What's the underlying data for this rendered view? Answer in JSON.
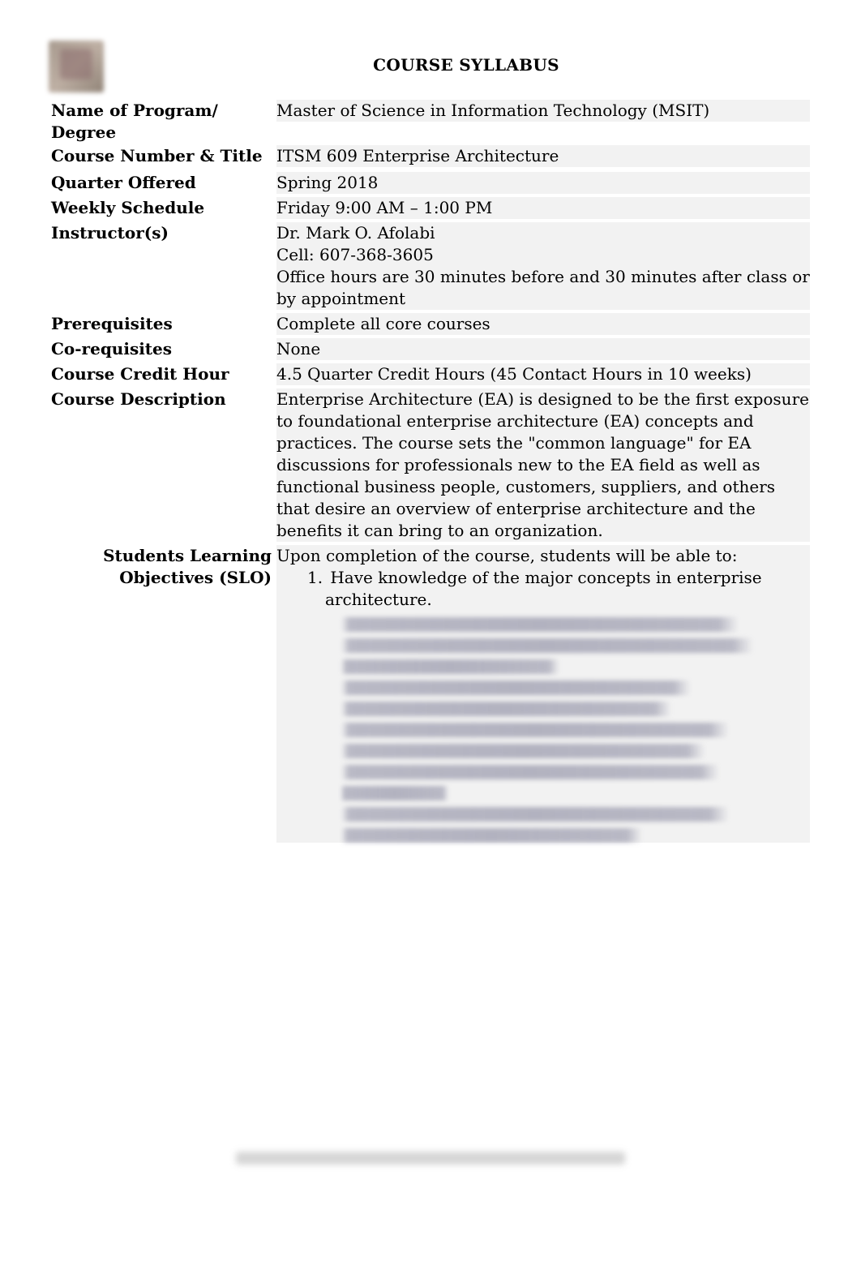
{
  "doc_title": "COURSE SYLLABUS",
  "fields": {
    "program_label": "Name of Program/ Degree",
    "program_value": "Master of Science in Information Technology (MSIT)",
    "course_num_label": "Course Number & Title",
    "course_num_value": "ITSM 609 Enterprise Architecture",
    "quarter_label": "Quarter Offered",
    "quarter_value": "Spring 2018",
    "schedule_label": "Weekly Schedule",
    "schedule_value": " Friday 9:00 AM – 1:00 PM",
    "instructor_label": "Instructor(s)",
    "instructor_name": "Dr. Mark O. Afolabi",
    "instructor_cell": "Cell: 607-368-3605",
    "instructor_hours": "Office hours are 30 minutes before and 30 minutes after class or by appointment",
    "prereq_label": "Prerequisites",
    "prereq_value": "Complete all core courses",
    "coreq_label": "Co-requisites",
    "coreq_value": "None",
    "credit_label": "Course Credit Hour",
    "credit_value": "4.5 Quarter Credit Hours (45 Contact Hours in 10 weeks)",
    "desc_label": "Course Description",
    "desc_value": "Enterprise Architecture (EA) is designed to be the first exposure to foundational enterprise architecture (EA) concepts and practices. The course sets the \"common language\" for EA discussions for professionals new to the EA field as well as functional business people, customers, suppliers, and others that desire an overview of enterprise architecture and the benefits it can bring to an organization.",
    "slo_label_1": "Students Learning",
    "slo_label_2": "Objectives (SLO)",
    "slo_intro": "Upon completion of the course, students will be able to:",
    "slo_item_1_num": "1.",
    "slo_item_1_text": "Have knowledge of the major concepts in enterprise",
    "slo_item_1_cont": "architecture."
  }
}
